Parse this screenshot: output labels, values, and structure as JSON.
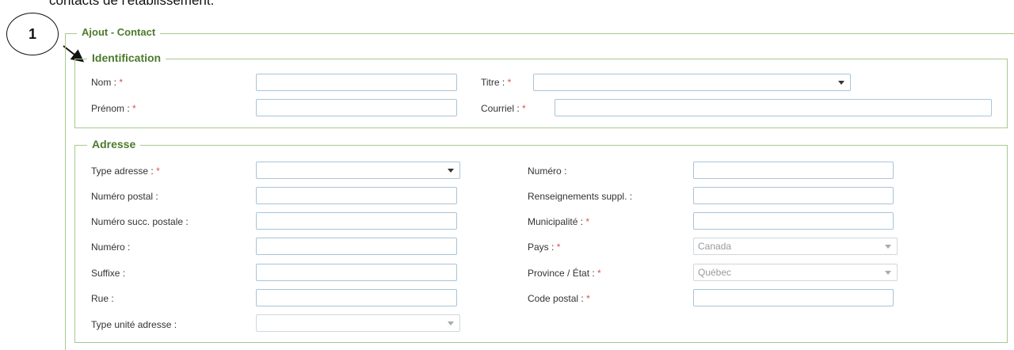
{
  "top_text": "contacts de l'établissement.",
  "callout_number": "1",
  "form": {
    "title": "Ajout - Contact",
    "identification": {
      "legend": "Identification",
      "nom_label": "Nom :",
      "prenom_label": "Prénom :",
      "titre_label": "Titre :",
      "courriel_label": "Courriel :",
      "required_mark": "*"
    },
    "adresse": {
      "legend": "Adresse",
      "left_labels": {
        "type_adresse": "Type adresse :",
        "numero_postal": "Numéro postal :",
        "numero_succ": "Numéro succ. postale :",
        "numero": "Numéro :",
        "suffixe": "Suffixe :",
        "rue": "Rue :",
        "type_unite": "Type unité adresse :"
      },
      "right_labels": {
        "numero": "Numéro :",
        "renseignements": "Renseignements suppl. :",
        "municipalite": "Municipalité :",
        "pays": "Pays :",
        "province": "Province / État :",
        "code_postal": "Code postal :"
      },
      "pays_value": "Canada",
      "province_value": "Québec"
    }
  }
}
